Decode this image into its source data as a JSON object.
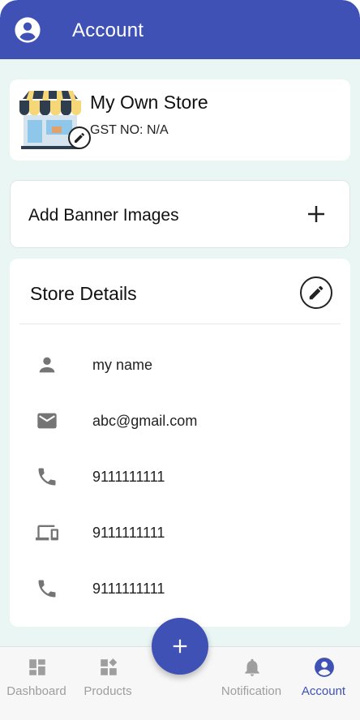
{
  "appbar": {
    "title": "Account",
    "icon": "account-circle-icon"
  },
  "store": {
    "name": "My Own Store",
    "gst": "GST NO: N/A"
  },
  "banner": {
    "label": "Add Banner Images"
  },
  "details": {
    "title": "Store Details",
    "rows": [
      {
        "icon": "person-icon",
        "text": "my name"
      },
      {
        "icon": "mail-icon",
        "text": "abc@gmail.com"
      },
      {
        "icon": "phone-icon",
        "text": "9111111111"
      },
      {
        "icon": "devices-icon",
        "text": "9111111111"
      },
      {
        "icon": "phone-icon",
        "text": "9111111111"
      }
    ]
  },
  "nav": {
    "items": [
      {
        "label": "Dashboard",
        "icon": "dashboard-icon"
      },
      {
        "label": "Products",
        "icon": "products-icon"
      },
      {
        "label": "Notification",
        "icon": "bell-icon"
      },
      {
        "label": "Account",
        "icon": "account-circle-icon",
        "active": true
      }
    ]
  },
  "colors": {
    "primary": "#3f51b5",
    "background": "#e9f6f4",
    "inactive": "#9e9e9e"
  }
}
